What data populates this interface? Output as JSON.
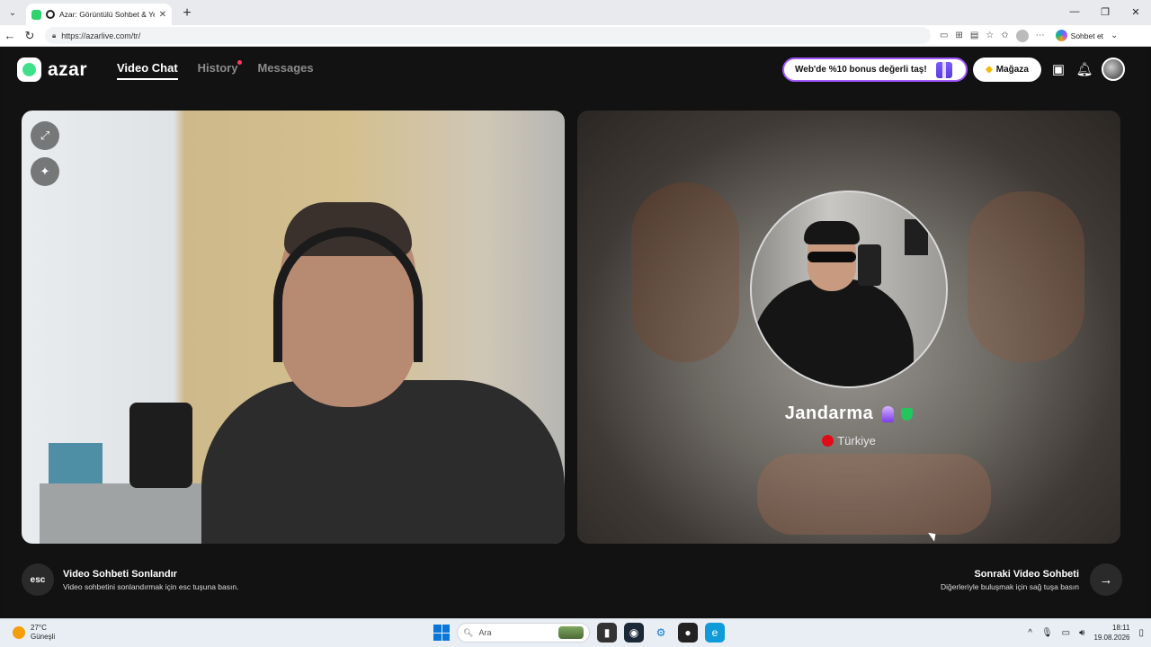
{
  "browser": {
    "tab_title": "Azar: Görüntülü Sohbet & Yer",
    "tab_close": "✕",
    "new_tab": "+",
    "url": "https://azarlive.com/tr/",
    "copilot_label": "Sohbet et",
    "window_controls": [
      "—",
      "❐",
      "✕"
    ]
  },
  "app": {
    "logo_text": "azar",
    "nav": {
      "video_chat": "Video Chat",
      "history": "History",
      "messages": "Messages"
    },
    "promo_text": "Web'de %10 bonus değerli taş!",
    "store_label": "Mağaza"
  },
  "partner": {
    "name": "Jandarma",
    "country": "Türkiye"
  },
  "actions": {
    "end": {
      "key": "esc",
      "title": "Video Sohbeti Sonlandır",
      "subtitle": "Video sohbetini sonlandırmak için esc tuşuna basın."
    },
    "next": {
      "key_icon": "→",
      "title": "Sonraki Video Sohbeti",
      "subtitle": "Diğerleriyle buluşmak için sağ tuşa basın"
    }
  },
  "taskbar": {
    "temperature": "27°C",
    "weather": "Güneşli",
    "search_placeholder": "Ara",
    "time": "18:11",
    "date": "19.08.2026"
  },
  "icons": {
    "screen_expand": "expand-icon",
    "effects": "magic-wand-icon",
    "store_gem": "gem-icon",
    "shop": "shop-icon",
    "bell": "bell-icon"
  },
  "colors": {
    "brand_green": "#3ee08b",
    "app_bg": "#121212",
    "promo_border": "#a259ff",
    "notification_dot": "#ff3b5c"
  }
}
